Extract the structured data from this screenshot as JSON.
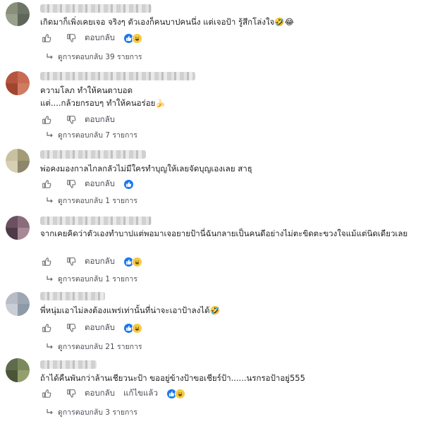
{
  "comments": [
    {
      "text": "เกิดมาก็เพิ่งเคยเจอ จริงๆ ตัวเองก็คนบาปคนนึ่ง แต่เจอป้า รู้สึกโล่งใจ🤣😂",
      "reply_label": "ตอบกลับ",
      "reactions": [
        "like-reaction",
        "haha-reaction"
      ],
      "replies_label": "ดูการตอบกลับ 39 รายการ",
      "avatar_colors": [
        "#8a8f7c",
        "#6d7468",
        "#9aa08e",
        "#5e6759"
      ]
    },
    {
      "text": "ความโลภ ทำให้คนตาบอด\nแต่....กล้วยกรอบๆ ทำให้คนอร่อย🍌",
      "reply_label": "ตอบกลับ",
      "reactions": [],
      "replies_label": "ดูการตอบกลับ 7 รายการ",
      "avatar_colors": [
        "#b5553f",
        "#c96a52",
        "#a2452f",
        "#cf7c62"
      ]
    },
    {
      "text": "พ่อคงมองกาลไกลกลัวไม่มีใครทำบุญให้เลยจัดบุญเองเลย สาธุ",
      "reply_label": "ตอบกลับ",
      "reactions": [
        "like-reaction"
      ],
      "replies_label": "ดูการตอบกลับ 1 รายการ",
      "avatar_colors": [
        "#c9c0a0",
        "#a39a78",
        "#d7cfb2",
        "#8e866a"
      ]
    },
    {
      "text": "จากเคยคิดว่าตัวเองทำบาปแต่พอมาเจอยายป้านี่ฉันกลายเป็นคนดีอย่างไม่ตะขิดตะขวงใจแม้แต่นิดเดียวเลย",
      "reply_label": "ตอบกลับ",
      "reactions": [
        "like-reaction",
        "haha-reaction"
      ],
      "replies_label": "ดูการตอบกลับ 1 รายการ",
      "avatar_colors": [
        "#6b5160",
        "#8a6c7c",
        "#4f3a47",
        "#a88796"
      ]
    },
    {
      "text": "พี่หนุ่มเอาไม่ลงต้องแพร่เท่านั้นที่น่าจะเอาป้าลงได้🤣",
      "reply_label": "ตอบกลับ",
      "reactions": [
        "like-reaction",
        "haha-reaction"
      ],
      "replies_label": "ดูการตอบกลับ 21 รายการ",
      "avatar_colors": [
        "#b7bcc6",
        "#9da7b3",
        "#c9ced6",
        "#8e9aa8"
      ]
    },
    {
      "text": "ถ้าได้คืนพันกว่าล้านเชียวนะป้า ขออยู่ข้างป้าขอเชียร์ป้า......นรกรอป้าอยู่555",
      "reply_label": "ตอบกลับ",
      "edited_label": "แก้ไขแล้ว",
      "reactions": [
        "like-reaction",
        "haha-reaction"
      ],
      "replies_label": "ดูการตอบกลับ 3 รายการ",
      "avatar_colors": [
        "#5f6b4a",
        "#7b8a5d",
        "#4a5538",
        "#93a06e"
      ]
    }
  ]
}
